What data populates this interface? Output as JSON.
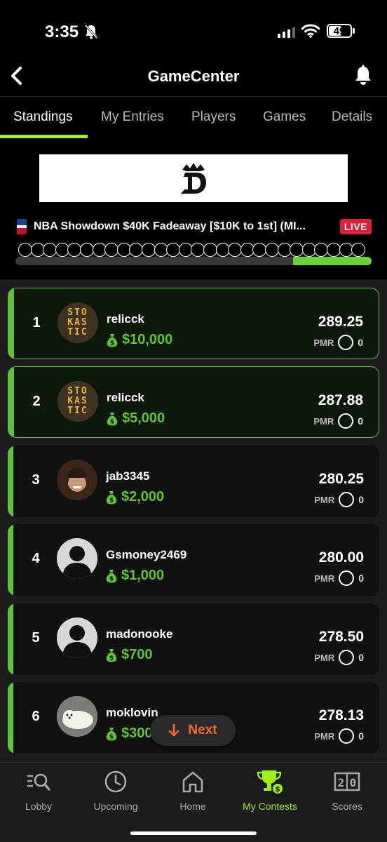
{
  "status_bar": {
    "time": "3:35",
    "battery": "49"
  },
  "header": {
    "title": "GameCenter"
  },
  "tabs": [
    {
      "label": "Standings",
      "active": true
    },
    {
      "label": "My Entries",
      "active": false
    },
    {
      "label": "Players",
      "active": false
    },
    {
      "label": "Games",
      "active": false
    },
    {
      "label": "Details",
      "active": false
    }
  ],
  "contest": {
    "name": "NBA Showdown $40K Fadeaway [$10K to 1st]  (MI...",
    "status": "LIVE",
    "progress_fraction": 0.22
  },
  "standings": [
    {
      "rank": "1",
      "username": "relicck",
      "prize": "$10,000",
      "score": "289.25",
      "pmr_label": "PMR",
      "pmr": "0",
      "avatar": "stokastic",
      "winning": true
    },
    {
      "rank": "2",
      "username": "relicck",
      "prize": "$5,000",
      "score": "287.88",
      "pmr_label": "PMR",
      "pmr": "0",
      "avatar": "stokastic",
      "winning": true
    },
    {
      "rank": "3",
      "username": "jab3345",
      "prize": "$2,000",
      "score": "280.25",
      "pmr_label": "PMR",
      "pmr": "0",
      "avatar": "photo",
      "winning": false
    },
    {
      "rank": "4",
      "username": "Gsmoney2469",
      "prize": "$1,000",
      "score": "280.00",
      "pmr_label": "PMR",
      "pmr": "0",
      "avatar": "default",
      "winning": false
    },
    {
      "rank": "5",
      "username": "madonooke",
      "prize": "$700",
      "score": "278.50",
      "pmr_label": "PMR",
      "pmr": "0",
      "avatar": "default",
      "winning": false
    },
    {
      "rank": "6",
      "username": "moklovin",
      "prize": "$300",
      "score": "278.13",
      "pmr_label": "PMR",
      "pmr": "0",
      "avatar": "photo",
      "winning": false
    }
  ],
  "stokastic_logo": {
    "line1": "STO",
    "line2": "KAS",
    "line3": "TIC"
  },
  "next_button": {
    "label": "Next"
  },
  "bottom_nav": [
    {
      "label": "Lobby",
      "icon": "lobby-search-icon",
      "active": false
    },
    {
      "label": "Upcoming",
      "icon": "clock-icon",
      "active": false
    },
    {
      "label": "Home",
      "icon": "home-icon",
      "active": false
    },
    {
      "label": "My Contests",
      "icon": "trophy-icon",
      "active": true
    },
    {
      "label": "Scores",
      "icon": "scoreboard-icon",
      "active": false
    }
  ],
  "colors": {
    "accent_green": "#9ef01a",
    "prize_green": "#5fc437",
    "live_red": "#d9223a",
    "next_orange": "#f26a2e"
  }
}
